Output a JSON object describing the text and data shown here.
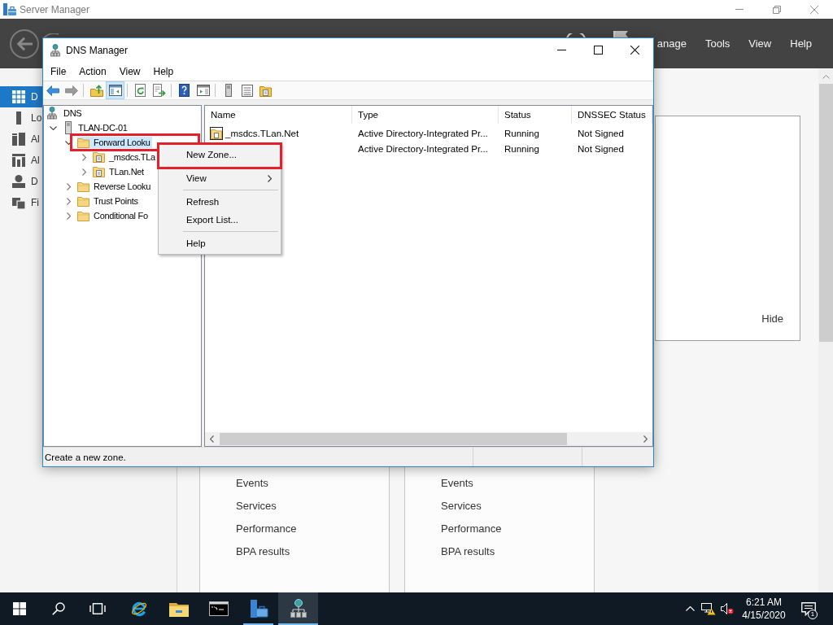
{
  "server_manager": {
    "title": "Server Manager",
    "menu": [
      "anage",
      "Tools",
      "View",
      "Help"
    ],
    "nav": [
      {
        "label": "D",
        "selected": true
      },
      {
        "label": "Lo",
        "selected": false
      },
      {
        "label": "Al",
        "selected": false
      },
      {
        "label": "Al",
        "selected": false
      },
      {
        "label": "D",
        "selected": false
      },
      {
        "label": "Fi",
        "selected": false
      }
    ],
    "panel": {
      "hide_link": "Hide"
    },
    "tiles": [
      {
        "rows": [
          "Events",
          "Services",
          "Performance",
          "BPA results"
        ]
      },
      {
        "rows": [
          "Events",
          "Services",
          "Performance",
          "BPA results"
        ]
      }
    ]
  },
  "dns_manager": {
    "title": "DNS Manager",
    "menu": [
      "File",
      "Action",
      "View",
      "Help"
    ],
    "toolbar": [
      {
        "kind": "button",
        "pressed": false,
        "disabled": false
      },
      {
        "kind": "button",
        "pressed": false,
        "disabled": true
      },
      {
        "kind": "separator"
      },
      {
        "kind": "button",
        "pressed": false,
        "disabled": false
      },
      {
        "kind": "button",
        "pressed": true,
        "disabled": false
      },
      {
        "kind": "separator"
      },
      {
        "kind": "button",
        "pressed": false,
        "disabled": false
      },
      {
        "kind": "button",
        "pressed": false,
        "disabled": false
      },
      {
        "kind": "separator"
      },
      {
        "kind": "button",
        "pressed": false,
        "disabled": false
      },
      {
        "kind": "button",
        "pressed": false,
        "disabled": false
      },
      {
        "kind": "separator"
      },
      {
        "kind": "button",
        "pressed": false,
        "disabled": false
      },
      {
        "kind": "button",
        "pressed": false,
        "disabled": false
      },
      {
        "kind": "button",
        "pressed": false,
        "disabled": false
      }
    ],
    "tree": [
      {
        "label": "DNS",
        "selected": false,
        "highlighted": false,
        "children": [
          {
            "label": "TLAN-DC-01",
            "expanded": true,
            "selected": false,
            "highlighted": false,
            "children": [
              {
                "label": "Forward Looku",
                "expanded": true,
                "selected": true,
                "highlighted": true,
                "children": [
                  {
                    "label": "_msdcs.TLa",
                    "expanded": false,
                    "selected": false,
                    "highlighted": false
                  },
                  {
                    "label": "TLan.Net",
                    "expanded": false,
                    "selected": false,
                    "highlighted": false
                  }
                ]
              },
              {
                "label": "Reverse Looku",
                "expanded": false,
                "selected": false,
                "highlighted": false
              },
              {
                "label": "Trust Points",
                "expanded": false,
                "selected": false,
                "highlighted": false
              },
              {
                "label": "Conditional Fo",
                "expanded": false,
                "selected": false,
                "highlighted": false
              }
            ]
          }
        ]
      }
    ],
    "columns": [
      {
        "label": "Name"
      },
      {
        "label": "Type"
      },
      {
        "label": "Status"
      },
      {
        "label": "DNSSEC Status"
      }
    ],
    "rows": [
      {
        "selected": false,
        "name": "_msdcs.TLan.Net",
        "type": "Active Directory-Integrated Pr...",
        "status": "Running",
        "dnssec_status": "Not Signed"
      },
      {
        "selected": false,
        "type": "Active Directory-Integrated Pr...",
        "status": "Running",
        "dnssec_status": "Not Signed"
      }
    ],
    "status_bar": "Create a new zone."
  },
  "context_menu": {
    "items": [
      {
        "kind": "item",
        "label": "New Zone...",
        "submenu": false,
        "highlighted": true
      },
      {
        "kind": "item",
        "label": "View",
        "submenu": true,
        "highlighted": false
      },
      {
        "kind": "separator"
      },
      {
        "kind": "item",
        "label": "Refresh",
        "submenu": false,
        "highlighted": false
      },
      {
        "kind": "item",
        "label": "Export List...",
        "submenu": false,
        "highlighted": false
      },
      {
        "kind": "separator"
      },
      {
        "kind": "item",
        "label": "Help",
        "submenu": false,
        "highlighted": false
      }
    ]
  },
  "taskbar": {
    "buttons": [
      {
        "running": false,
        "active": false
      },
      {
        "running": false,
        "active": false
      },
      {
        "running": false,
        "active": false
      },
      {
        "running": false,
        "active": false
      },
      {
        "running": false,
        "active": false
      },
      {
        "running": false,
        "active": false
      },
      {
        "running": true,
        "active": false
      },
      {
        "running": true,
        "active": true
      }
    ],
    "time": "6:21 AM",
    "date": "4/15/2020",
    "notification_count": "1"
  }
}
